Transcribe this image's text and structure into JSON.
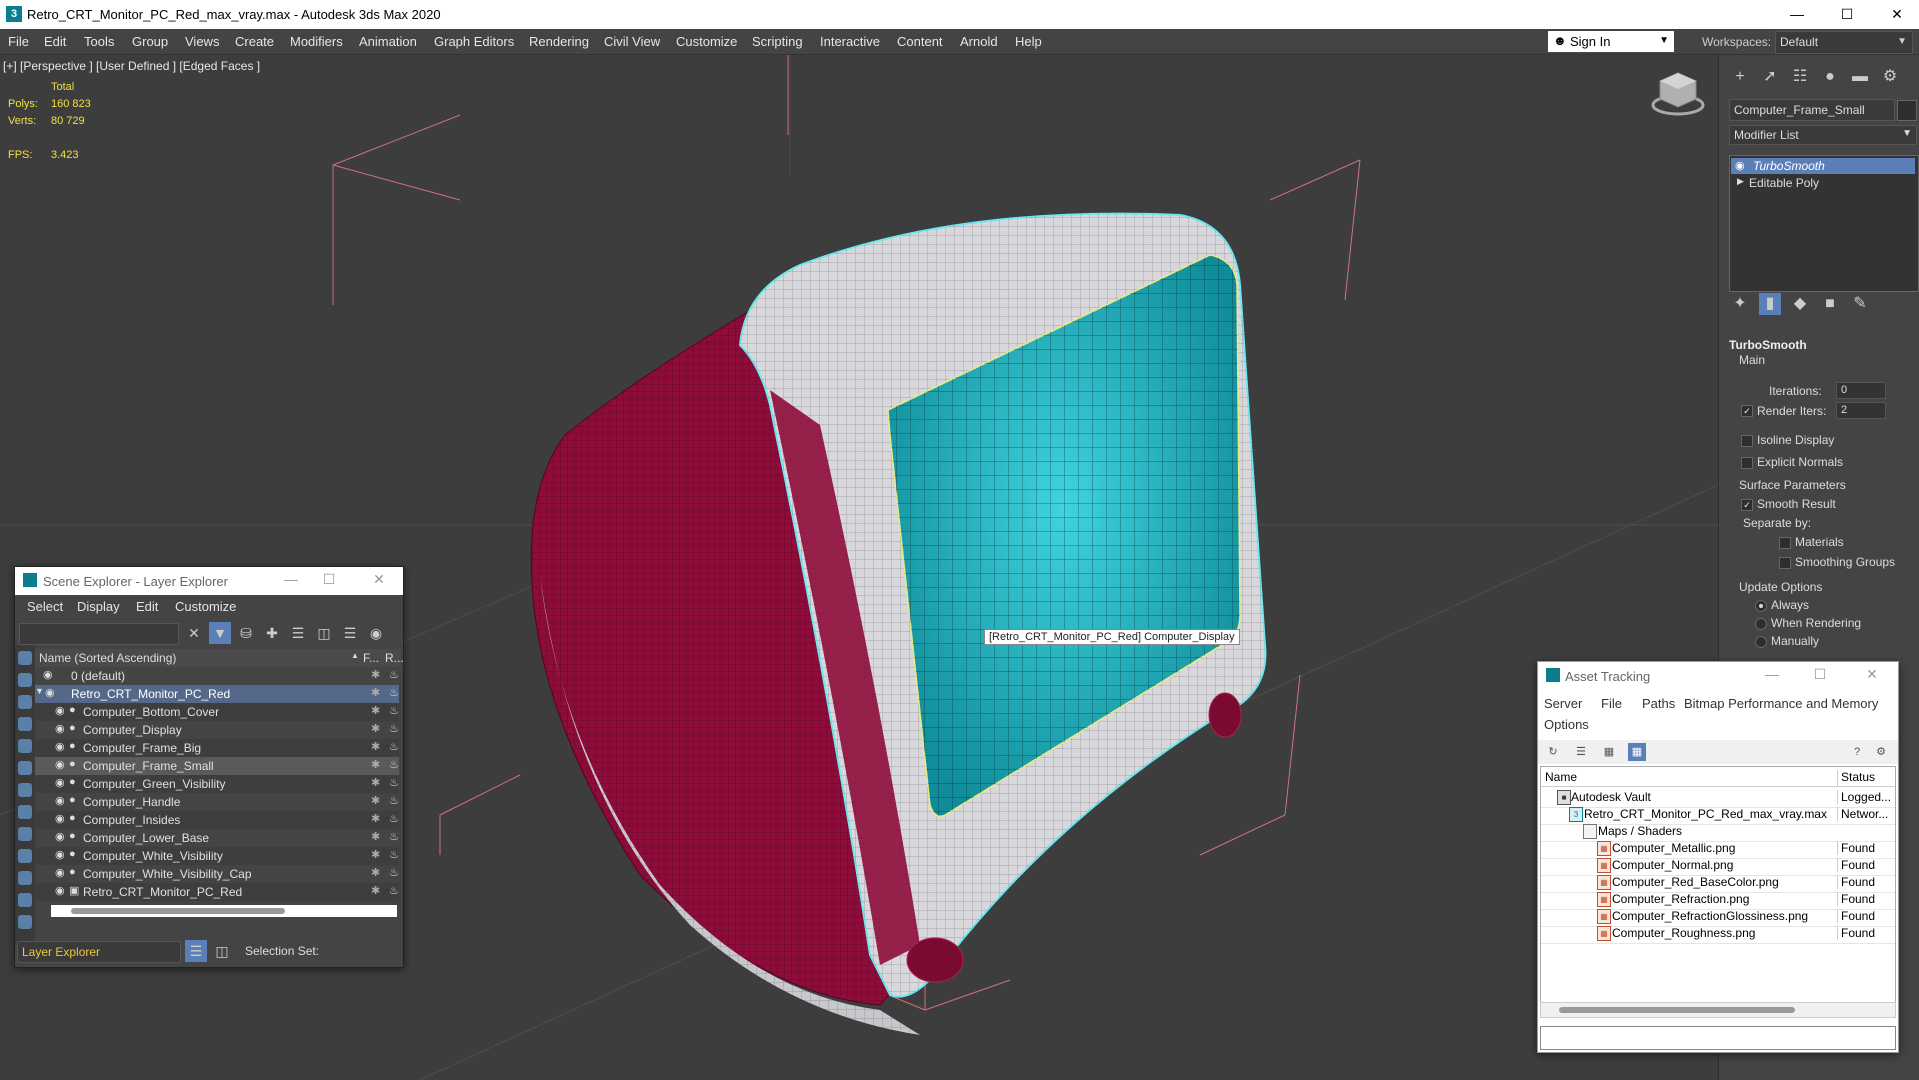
{
  "window": {
    "title": "Retro_CRT_Monitor_PC_Red_max_vray.max - Autodesk 3ds Max 2020",
    "logo_glyph": "3",
    "min_glyph": "—",
    "max_glyph": "☐",
    "close_glyph": "✕"
  },
  "menubar": {
    "items": [
      "File",
      "Edit",
      "Tools",
      "Group",
      "Views",
      "Create",
      "Modifiers",
      "Animation",
      "Graph Editors",
      "Rendering",
      "Civil View",
      "Customize",
      "Scripting",
      "Interactive",
      "Content",
      "Arnold",
      "Help"
    ],
    "sign_in": "Sign In",
    "workspaces_label": "Workspaces:",
    "workspace_value": "Default"
  },
  "viewport": {
    "label": "[+] [Perspective ] [User Defined ] [Edged Faces ]",
    "stats_total": "Total",
    "polys_label": "Polys:",
    "polys_value": "160 823",
    "verts_label": "Verts:",
    "verts_value": "80 729",
    "fps_label": "FPS:",
    "fps_value": "3.423",
    "tooltip": "[Retro_CRT_Monitor_PC_Red] Computer_Display",
    "screen_color": "#1fb4c2",
    "shell_color": "#8e0c3a",
    "frame_color": "#d8d8dc"
  },
  "command_panel": {
    "object_name": "Computer_Frame_Small",
    "modifier_list": "Modifier List",
    "stack": [
      "TurboSmooth",
      "Editable Poly"
    ],
    "rollout_title": "TurboSmooth",
    "main_label": "Main",
    "iterations_label": "Iterations:",
    "iterations_value": "0",
    "render_iters_label": "Render Iters:",
    "render_iters_value": "2",
    "isoline_label": "Isoline Display",
    "explicit_normals_label": "Explicit Normals",
    "surface_params_label": "Surface Parameters",
    "smooth_result_label": "Smooth Result",
    "separate_by_label": "Separate by:",
    "materials_label": "Materials",
    "smoothing_groups_label": "Smoothing Groups",
    "update_options_label": "Update Options",
    "always_label": "Always",
    "when_rendering_label": "When Rendering",
    "manually_label": "Manually"
  },
  "scene_explorer": {
    "title": "Scene Explorer - Layer Explorer",
    "menus": [
      "Select",
      "Display",
      "Edit",
      "Customize"
    ],
    "col_name": "Name (Sorted Ascending)",
    "col_f": "F...",
    "col_r": "R...",
    "rows": [
      {
        "name": "0 (default)"
      },
      {
        "name": "Retro_CRT_Monitor_PC_Red"
      },
      {
        "name": "Computer_Bottom_Cover"
      },
      {
        "name": "Computer_Display"
      },
      {
        "name": "Computer_Frame_Big"
      },
      {
        "name": "Computer_Frame_Small"
      },
      {
        "name": "Computer_Green_Visibility"
      },
      {
        "name": "Computer_Handle"
      },
      {
        "name": "Computer_Insides"
      },
      {
        "name": "Computer_Lower_Base"
      },
      {
        "name": "Computer_White_Visibility"
      },
      {
        "name": "Computer_White_Visibility_Cap"
      },
      {
        "name": "Retro_CRT_Monitor_PC_Red"
      }
    ],
    "footer_explorer": "Layer Explorer",
    "selection_set": "Selection Set:"
  },
  "asset_tracking": {
    "title": "Asset Tracking",
    "menus": [
      "Server",
      "File",
      "Paths",
      "Bitmap Performance and Memory",
      "Options"
    ],
    "col_name": "Name",
    "col_status": "Status",
    "rows": [
      {
        "name": "Autodesk Vault",
        "status": "Logged..."
      },
      {
        "name": "Retro_CRT_Monitor_PC_Red_max_vray.max",
        "status": "Networ..."
      },
      {
        "name": "Maps / Shaders",
        "status": ""
      },
      {
        "name": "Computer_Metallic.png",
        "status": "Found"
      },
      {
        "name": "Computer_Normal.png",
        "status": "Found"
      },
      {
        "name": "Computer_Red_BaseColor.png",
        "status": "Found"
      },
      {
        "name": "Computer_Refraction.png",
        "status": "Found"
      },
      {
        "name": "Computer_RefractionGlossiness.png",
        "status": "Found"
      },
      {
        "name": "Computer_Roughness.png",
        "status": "Found"
      }
    ]
  }
}
